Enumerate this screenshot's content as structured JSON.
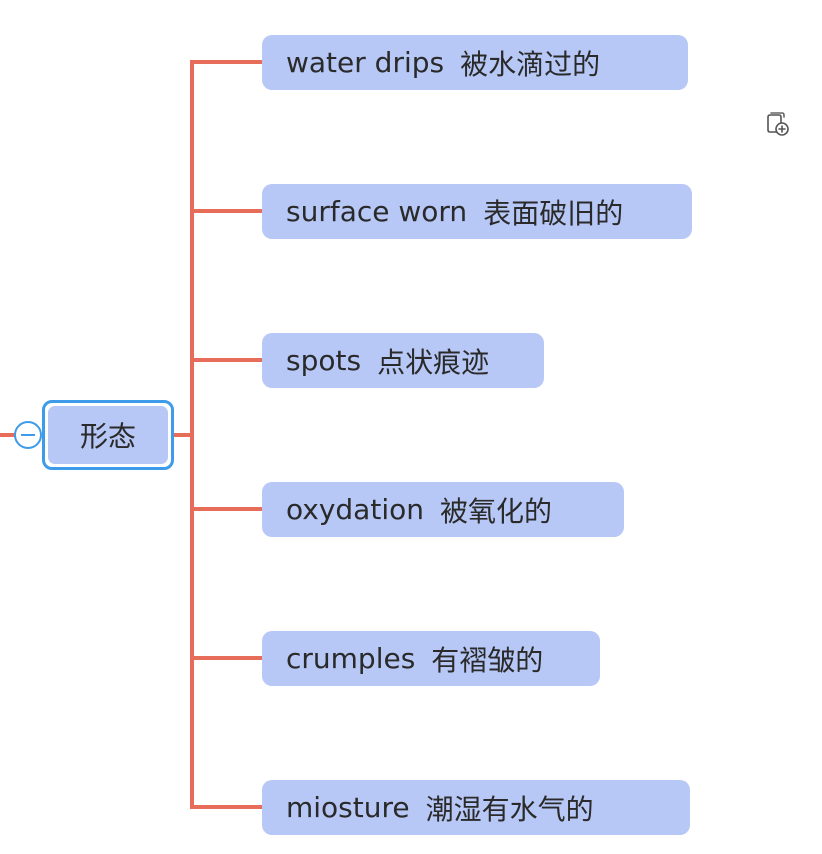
{
  "root": {
    "label": "形态"
  },
  "children": [
    {
      "en": "water  drips",
      "zh": "被水滴过的"
    },
    {
      "en": "surface worn",
      "zh": "表面破旧的"
    },
    {
      "en": "spots",
      "zh": "点状痕迹"
    },
    {
      "en": "oxydation",
      "zh": "被氧化的"
    },
    {
      "en": "crumples",
      "zh": "有褶皱的"
    },
    {
      "en": "miosture",
      "zh": "潮湿有水气的"
    }
  ],
  "colors": {
    "connector": "#e86c5a",
    "node_fill": "#b7c8f6",
    "selection_border": "#3d9be9",
    "text": "#2a2a2a"
  },
  "icons": {
    "collapse": "collapse-minus-icon",
    "add": "add-topic-icon"
  }
}
